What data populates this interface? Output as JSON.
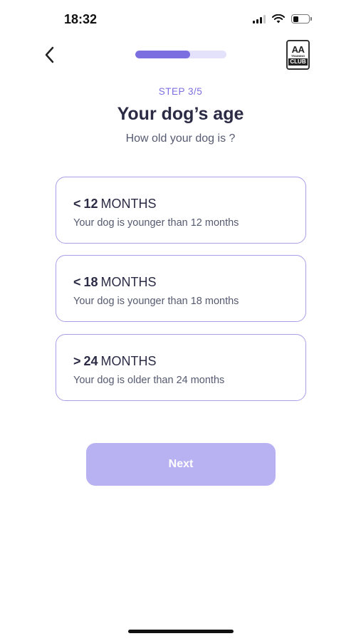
{
  "status_bar": {
    "time": "18:32"
  },
  "header": {
    "progress": 0.6
  },
  "logo": {
    "line1": "AA",
    "line2": "TRAINING",
    "line3": "CLUB"
  },
  "step": {
    "label": "STEP 3/5"
  },
  "title": "Your dog’s age",
  "subtitle": "How old your dog is ?",
  "options": [
    {
      "symbol": "<",
      "number": "12",
      "unit": "MONTHS",
      "description": "Your dog is younger than 12 months"
    },
    {
      "symbol": "<",
      "number": "18",
      "unit": "MONTHS",
      "description": "Your dog is younger than 18 months"
    },
    {
      "symbol": ">",
      "number": "24",
      "unit": "MONTHS",
      "description": "Your dog is older than 24 months"
    }
  ],
  "next_button": {
    "label": "Next"
  },
  "colors": {
    "accent": "#7b6ee0",
    "card_border": "#a99ee8",
    "button_disabled": "#b9b2f2"
  }
}
